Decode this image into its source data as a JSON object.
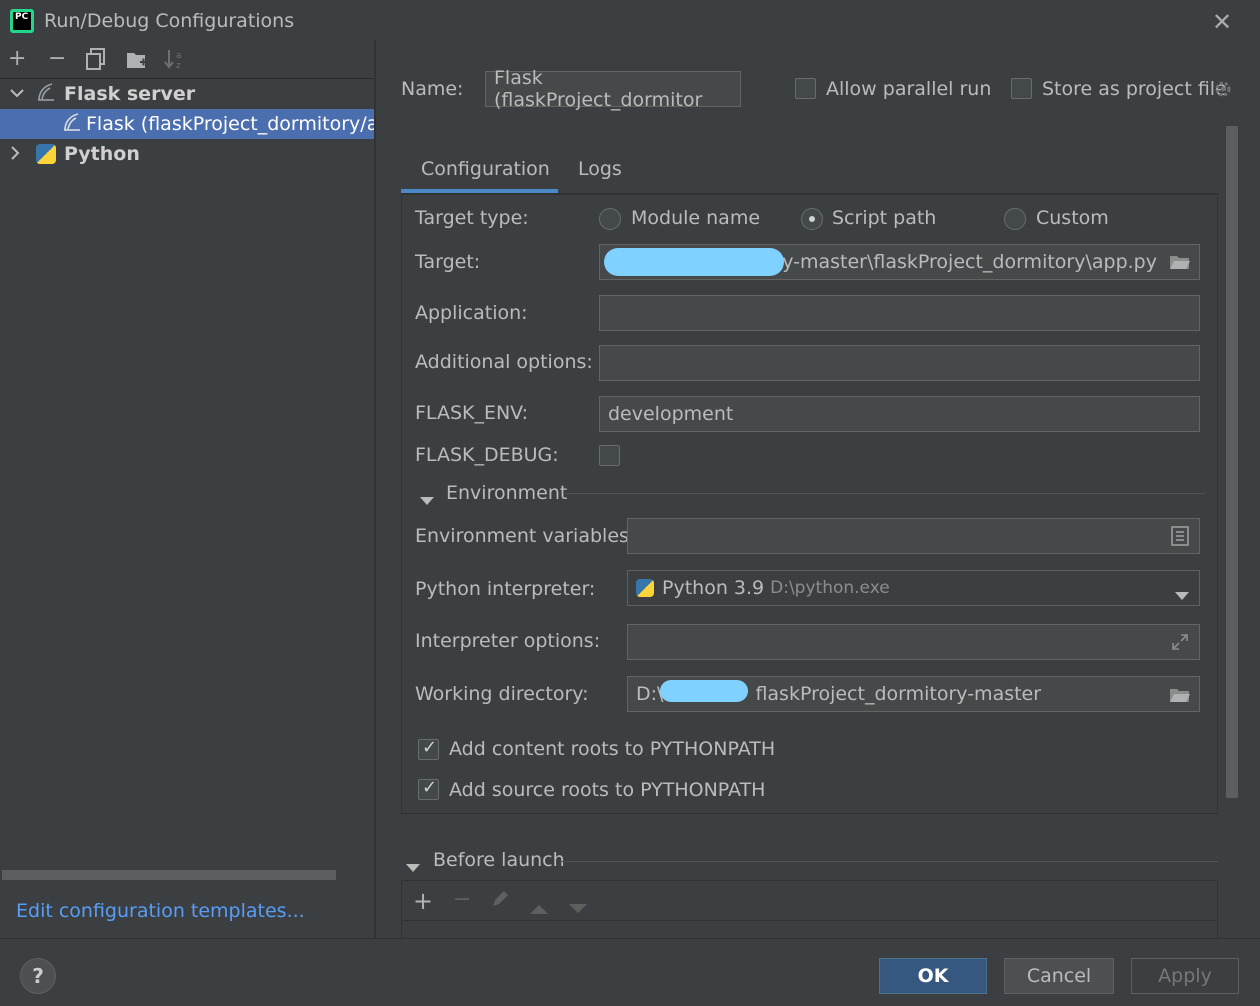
{
  "window": {
    "title": "Run/Debug Configurations",
    "app_icon_text": "PC"
  },
  "toolbar": {
    "add": "+",
    "remove": "−",
    "copy": "⧉",
    "folder": "📁",
    "sort": "↓a"
  },
  "tree": {
    "groups": [
      {
        "label": "Flask server",
        "expanded": true,
        "children": [
          {
            "label": "Flask (flaskProject_dormitory/app"
          }
        ]
      },
      {
        "label": "Python",
        "expanded": false
      }
    ]
  },
  "edit_templates_link": "Edit configuration templates...",
  "name_label": "Name:",
  "name_value": "Flask (flaskProject_dormitor",
  "allow_parallel_label": "Allow parallel run",
  "store_project_label": "Store as project file",
  "tabs": [
    {
      "label": "Configuration",
      "active": true
    },
    {
      "label": "Logs",
      "active": false
    }
  ],
  "config": {
    "target_type_label": "Target type:",
    "target_type_options": [
      "Module name",
      "Script path",
      "Custom"
    ],
    "target_type_selected": "Script path",
    "target_label": "Target:",
    "target_value": "itory-master\\flaskProject_dormitory\\app.py",
    "application_label": "Application:",
    "application_value": "",
    "additional_label": "Additional options:",
    "additional_value": "",
    "flask_env_label": "FLASK_ENV:",
    "flask_env_value": "development",
    "flask_debug_label": "FLASK_DEBUG:",
    "flask_debug_checked": false,
    "environment_section": "Environment",
    "env_vars_label": "Environment variables:",
    "env_vars_value": "",
    "interpreter_label": "Python interpreter:",
    "interpreter_name": "Python 3.9",
    "interpreter_path": "D:\\python.exe",
    "interp_options_label": "Interpreter options:",
    "interp_options_value": "",
    "workdir_label": "Working directory:",
    "workdir_prefix": "D:\\",
    "workdir_suffix": "flaskProject_dormitory-master",
    "content_roots_label": "Add content roots to PYTHONPATH",
    "content_roots_checked": true,
    "source_roots_label": "Add source roots to PYTHONPATH",
    "source_roots_checked": true
  },
  "before_launch": {
    "label": "Before launch"
  },
  "buttons": {
    "ok": "OK",
    "cancel": "Cancel",
    "apply": "Apply",
    "help": "?"
  },
  "colors": {
    "background": "#3c3f41",
    "selection": "#4b6eaf",
    "link": "#589df6",
    "primary_button": "#365880",
    "tab_underline": "#4a88c7"
  }
}
